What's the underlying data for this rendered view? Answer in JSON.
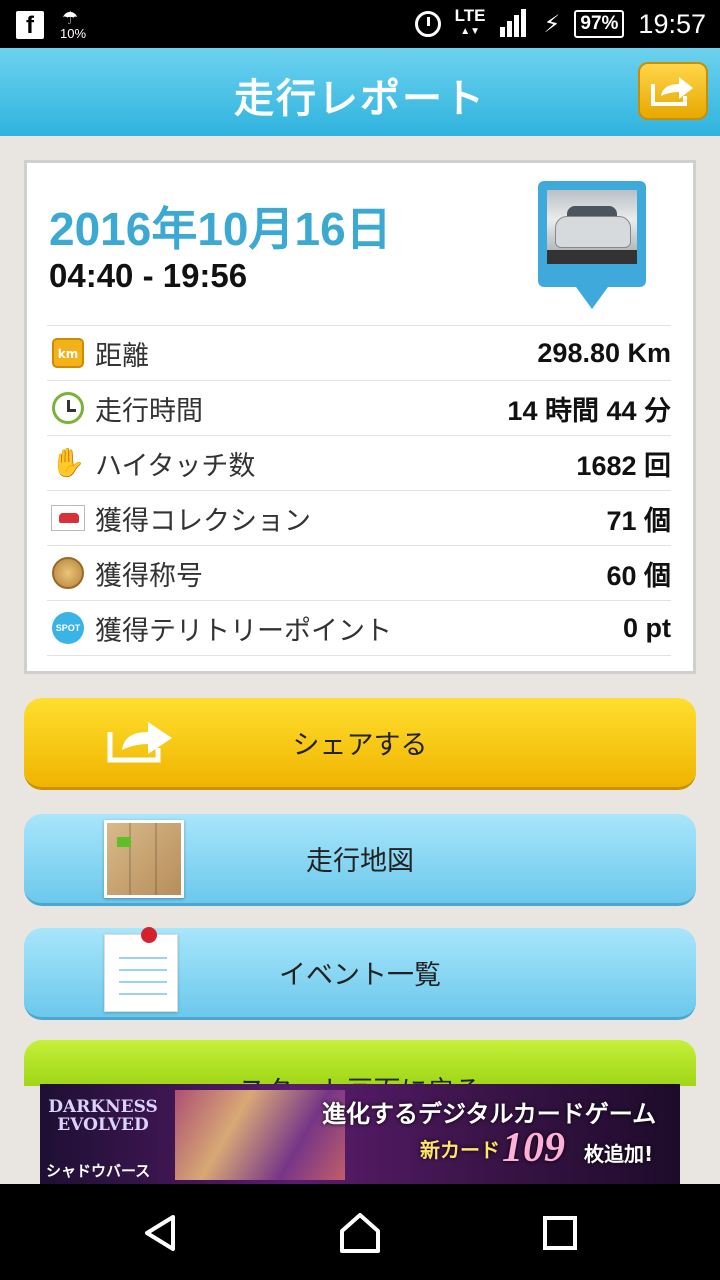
{
  "status_bar": {
    "weather_percent": "10%",
    "network": "LTE",
    "battery": "97%",
    "time": "19:57",
    "icons": [
      "facebook-icon",
      "weather-icon",
      "alarm-icon",
      "signal-icon",
      "charging-icon",
      "battery-icon"
    ]
  },
  "header": {
    "title": "走行レポート",
    "share_icon": "share-icon"
  },
  "report": {
    "date": "2016年10月16日",
    "time_range": "04:40 - 19:56",
    "rows": [
      {
        "icon": "km-icon",
        "icon_text": "km",
        "label": "距離",
        "value": "298.80 Km"
      },
      {
        "icon": "clock-icon",
        "label": "走行時間",
        "value": "14 時間 44 分"
      },
      {
        "icon": "high-touch-icon",
        "label": "ハイタッチ数",
        "value": "1682 回"
      },
      {
        "icon": "car-collection-icon",
        "label": "獲得コレクション",
        "value": "71 個"
      },
      {
        "icon": "medal-icon",
        "label": "獲得称号",
        "value": "60 個"
      },
      {
        "icon": "spot-icon",
        "icon_text": "SPOT",
        "label": "獲得テリトリーポイント",
        "value": "0 pt"
      }
    ]
  },
  "buttons": {
    "share": "シェアする",
    "map": "走行地図",
    "events": "イベント一覧",
    "start": "スタート画面に戻る"
  },
  "ad": {
    "logo_line1": "DARKNESS",
    "logo_line2": "EVOLVED",
    "logo_sub": "シャドウバース",
    "headline": "進化するデジタルカードゲーム",
    "new_card": "新カード",
    "number": "109",
    "suffix": "枚追加!"
  },
  "colors": {
    "header": "#2fb3de",
    "date": "#3ba9d2",
    "share_button": "#f0b400",
    "blue_button": "#6cc8ec",
    "green_button": "#9fd616"
  }
}
